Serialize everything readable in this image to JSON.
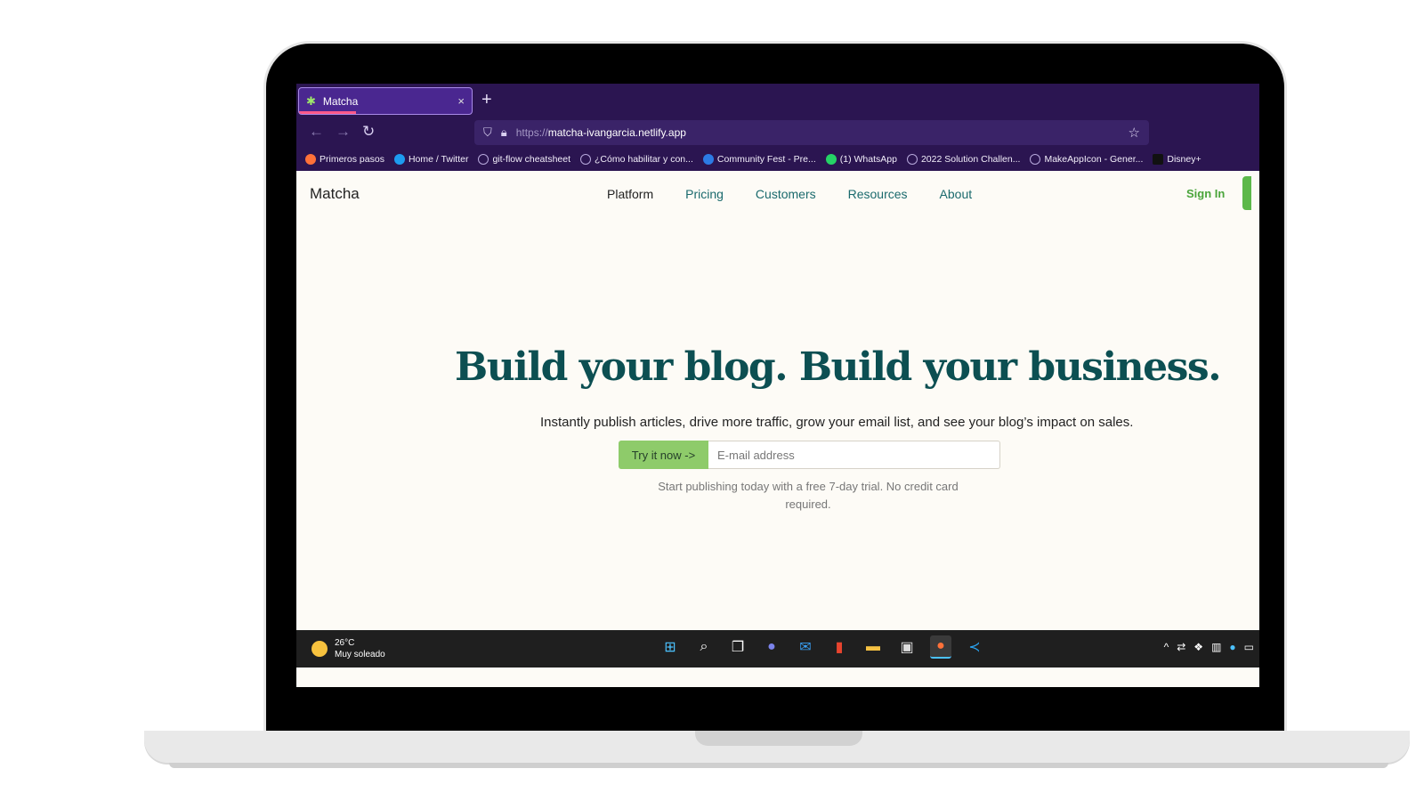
{
  "browser": {
    "tab_title": "Matcha",
    "tab_close": "×",
    "new_tab": "+",
    "url_scheme": "https://",
    "url_host": "matcha-ivangarcia.netlify.app",
    "bookmarks": [
      {
        "label": "Primeros pasos",
        "icon": "firefox-icon",
        "color": "#ff7139"
      },
      {
        "label": "Home / Twitter",
        "icon": "twitter-icon",
        "color": "#1d9bf0"
      },
      {
        "label": "git-flow cheatsheet",
        "icon": "globe-icon",
        "color": "#7a6aa8"
      },
      {
        "label": "¿Cómo habilitar y con...",
        "icon": "globe-icon",
        "color": "#7a6aa8"
      },
      {
        "label": "Community Fest - Pre...",
        "icon": "c-icon",
        "color": "#2c7be5"
      },
      {
        "label": "(1) WhatsApp",
        "icon": "whatsapp-icon",
        "color": "#25d366"
      },
      {
        "label": "2022 Solution Challen...",
        "icon": "globe-icon",
        "color": "#7a6aa8"
      },
      {
        "label": "MakeAppIcon - Gener...",
        "icon": "globe-icon",
        "color": "#7a6aa8"
      },
      {
        "label": "Disney+",
        "icon": "disney-icon",
        "color": "#111111"
      }
    ]
  },
  "site": {
    "brand": "Matcha",
    "nav": [
      "Platform",
      "Pricing",
      "Customers",
      "Resources",
      "About"
    ],
    "sign_in": "Sign In",
    "hero_title": "Build your blog. Build your business.",
    "hero_subtitle": "Instantly publish articles, drive more traffic, grow your email list, and see your blog’s impact on sales.",
    "cta_button": "Try it now ->",
    "email_placeholder": "E-mail address",
    "trial_note": "Start publishing today with a free 7-day trial. No credit card required."
  },
  "taskbar": {
    "temperature": "26°C",
    "weather": "Muy soleado",
    "apps": [
      "windows-start-icon",
      "search-icon",
      "task-view-icon",
      "teams-chat-icon",
      "mail-icon",
      "office-icon",
      "file-explorer-icon",
      "store-icon",
      "firefox-icon",
      "vscode-icon"
    ]
  },
  "colors": {
    "browser_bg": "#2b1551",
    "hero_title": "#0c4f52",
    "accent_green": "#8ecb6a",
    "page_bg": "#fdfbf6"
  }
}
